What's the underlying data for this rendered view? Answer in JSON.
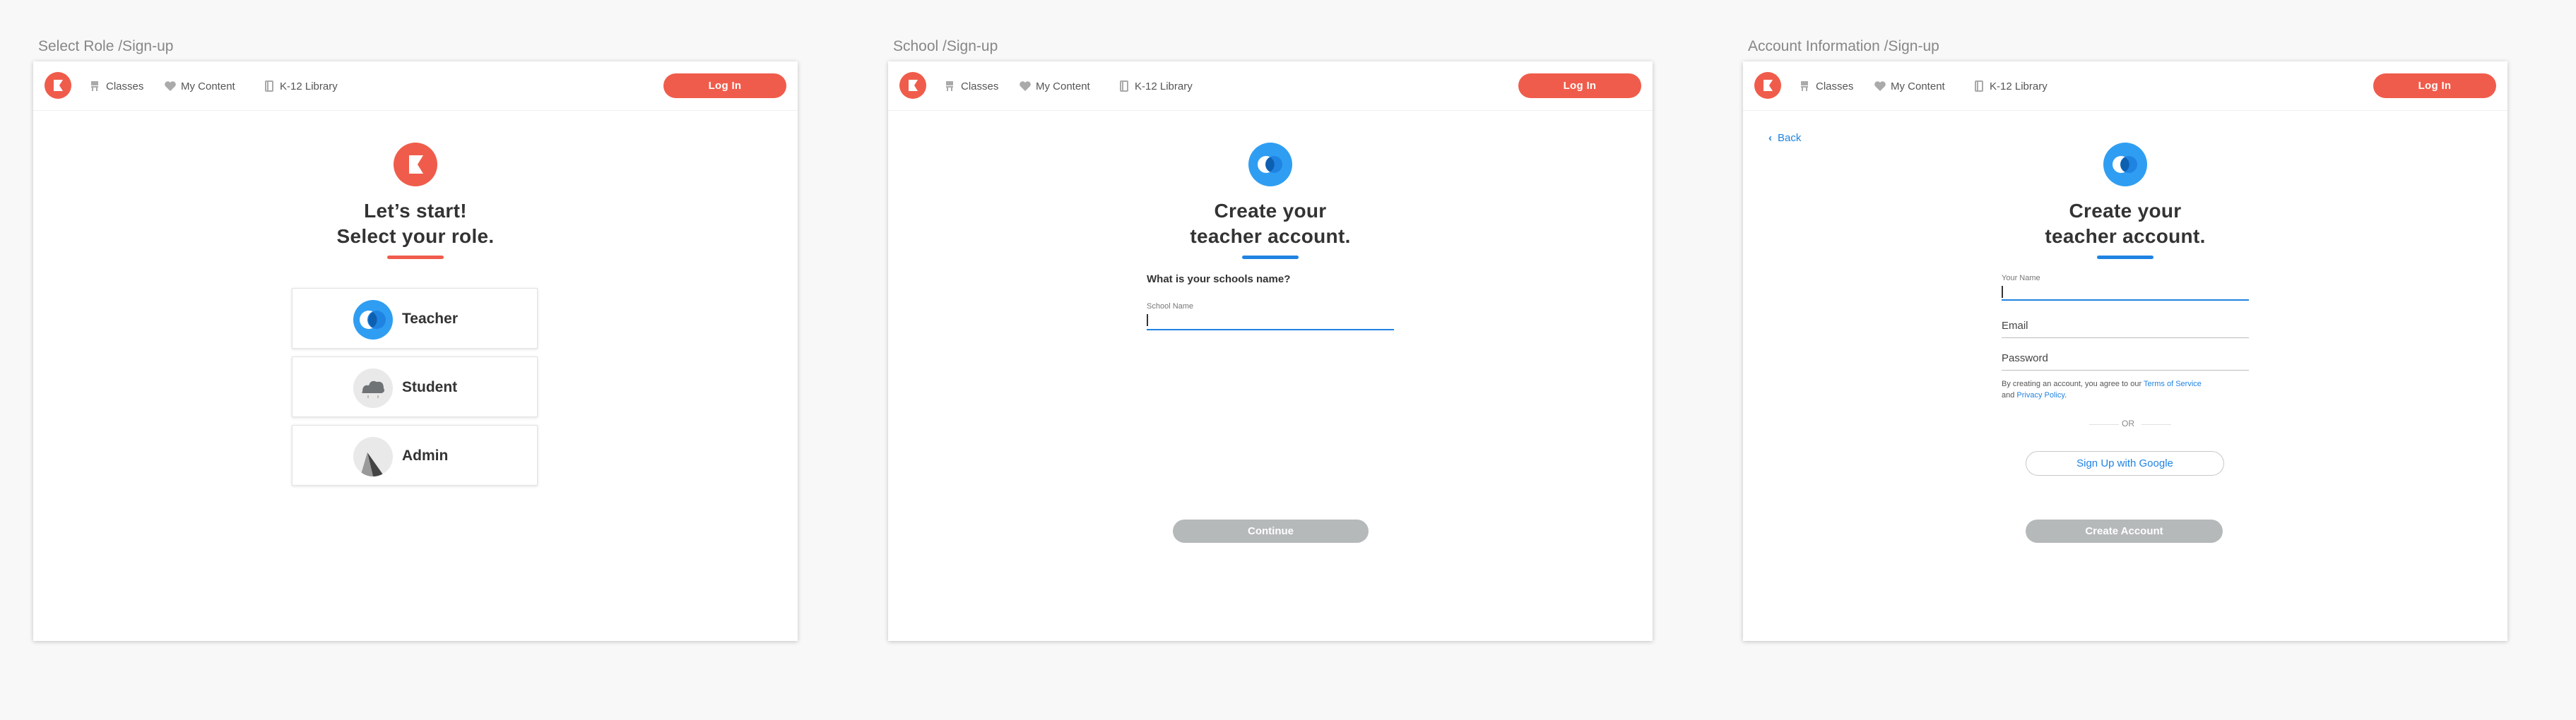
{
  "artboards": {
    "role": {
      "title": "Select Role /Sign-up"
    },
    "school": {
      "title": "School /Sign-up"
    },
    "account": {
      "title": "Account Information /Sign-up"
    }
  },
  "nav": {
    "classes": "Classes",
    "my_content": "My Content",
    "library": "K-12 Library",
    "login": "Log In"
  },
  "role_screen": {
    "headline_1": "Let’s start!",
    "headline_2": "Select your role.",
    "roles": [
      {
        "label": "Teacher",
        "icon": "teacher-avatar-icon"
      },
      {
        "label": "Student",
        "icon": "student-avatar-icon"
      },
      {
        "label": "Admin",
        "icon": "admin-avatar-icon"
      }
    ]
  },
  "school_screen": {
    "headline_1": "Create your",
    "headline_2": "teacher account.",
    "question": "What is your schools name?",
    "school_label": "School Name",
    "school_value": "",
    "continue": "Continue"
  },
  "account_screen": {
    "back": "Back",
    "headline_1": "Create your",
    "headline_2": "teacher account.",
    "name_label": "Your Name",
    "email_placeholder": "Email",
    "password_placeholder": "Password",
    "terms_prefix": "By creating an account, you agree to our ",
    "terms_link": "Terms of Service",
    "terms_and": "and ",
    "privacy_link": "Privacy Policy",
    "terms_suffix": ".",
    "or": "OR",
    "google": "Sign Up with Google",
    "create": "Create Account"
  },
  "colors": {
    "brand_red": "#f05c4b",
    "brand_blue": "#2f9ef2",
    "link_blue": "#1f83e2",
    "disabled": "#b5b9ba"
  }
}
